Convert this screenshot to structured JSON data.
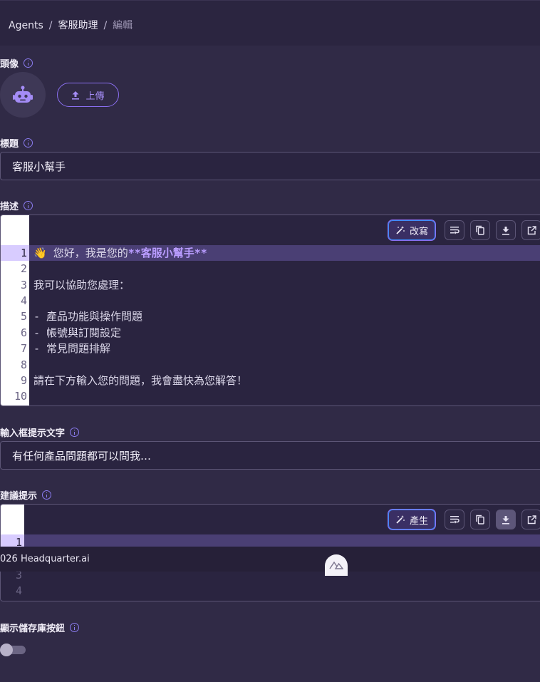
{
  "breadcrumb": {
    "root": "Agents",
    "sep": "/",
    "parent": "客服助理",
    "current": "編輯"
  },
  "avatar": {
    "label": "頭像",
    "icon": "robot-icon",
    "upload_label": "上傳"
  },
  "title_field": {
    "label": "標題",
    "value": "客服小幫手"
  },
  "description": {
    "label": "描述",
    "rewrite_label": "改寫",
    "lines": [
      {
        "n": "1",
        "text": "👋 您好，我是您的",
        "bold": "**客服小幫手**"
      },
      {
        "n": "2",
        "text": ""
      },
      {
        "n": "3",
        "text": "我可以協助您處理："
      },
      {
        "n": "4",
        "text": ""
      },
      {
        "n": "5",
        "text": "- 產品功能與操作問題"
      },
      {
        "n": "6",
        "text": "- 帳號與訂閱設定"
      },
      {
        "n": "7",
        "text": "- 常見問題排解"
      },
      {
        "n": "8",
        "text": ""
      },
      {
        "n": "9",
        "text": "請在下方輸入您的問題，我會盡快為您解答！"
      },
      {
        "n": "10",
        "text": ""
      }
    ]
  },
  "placeholder_field": {
    "label": "輸入框提示文字",
    "value": "有任何產品問題都可以問我…"
  },
  "suggestions": {
    "label": "建議提示",
    "generate_label": "產生",
    "lines": [
      {
        "n": "1"
      },
      {
        "n": "3"
      },
      {
        "n": "4"
      }
    ]
  },
  "footer": {
    "text": "026 Headquarter.ai"
  },
  "repo_toggle": {
    "label": "顯示儲存庫按鈕",
    "enabled": false
  },
  "colors": {
    "accent": "#8a6ff0",
    "background": "#302a46"
  }
}
